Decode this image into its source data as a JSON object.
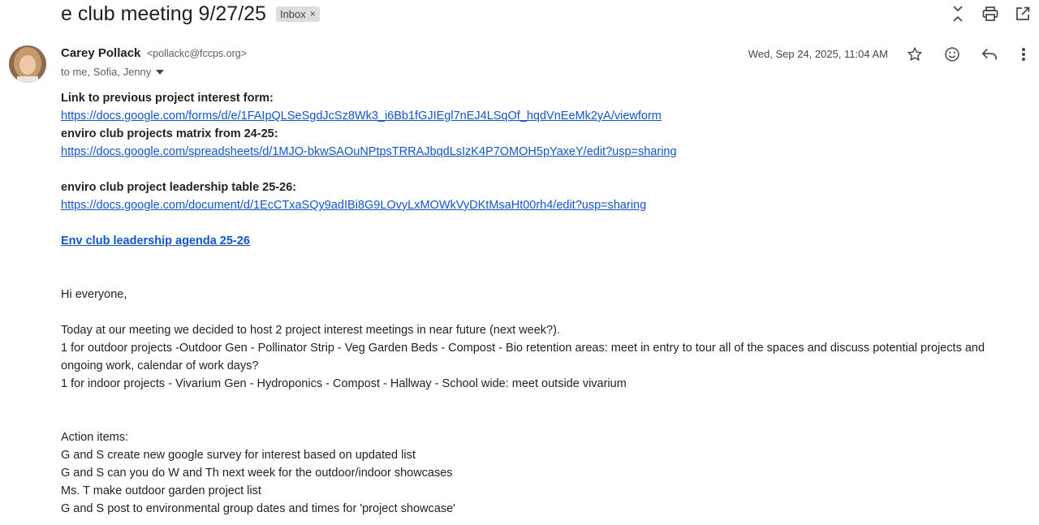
{
  "subject": "e club meeting 9/27/25",
  "label": {
    "text": "Inbox",
    "remove": "×"
  },
  "sender": {
    "name": "Carey Pollack",
    "email": "<pollackc@fccps.org>",
    "recipients": "to me, Sofia, Jenny"
  },
  "date": "Wed, Sep 24, 2025, 11:04 AM",
  "icons": {
    "toolbar": [
      "expand-collapse-icon",
      "print-icon",
      "open-new-window-icon"
    ],
    "message": [
      "star-icon",
      "emoji-icon",
      "reply-icon",
      "more-vert-icon"
    ]
  },
  "body": {
    "link1_label": "Link to previous project interest form:",
    "link1_url": "https://docs.google.com/forms/d/e/1FAIpQLSeSgdJcSz8Wk3_i6Bb1fGJIEgl7nEJ4LSqOf_hqdVnEeMk2yA/viewform",
    "link2_label": "enviro club projects matrix from 24-25:",
    "link2_url": "https://docs.google.com/spreadsheets/d/1MJO-bkwSAOuNPtpsTRRAJbqdLsIzK4P7OMOH5pYaxeY/edit?usp=sharing",
    "link3_label": "enviro club project leadership table 25-26:",
    "link3_url": "https://docs.google.com/document/d/1EcCTxaSQy9adIBi8G9LOvyLxMOWkVyDKtMsaHt00rh4/edit?usp=sharing",
    "agenda_link": "Env club leadership agenda 25-26",
    "greeting": "Hi everyone,",
    "para1": "Today at our meeting we decided to host 2 project interest meetings in near future (next week?).",
    "para2": "1 for outdoor projects  -Outdoor Gen - Pollinator Strip - Veg Garden Beds - Compost - Bio retention areas: meet in entry to tour all of the spaces and discuss potential projects and ongoing work, calendar of work days?",
    "para3": "1 for indoor projects - Vivarium Gen - Hydroponics - Compost - Hallway - School wide: meet outside vivarium",
    "action_title": "Action items:",
    "actions": [
      "G and S create new google survey for interest based on updated list",
      "G and S can you do W and Th next week for the outdoor/indoor showcases",
      "Ms. T make outdoor garden project list",
      "G and S post to environmental group dates and times for 'project showcase'"
    ]
  }
}
